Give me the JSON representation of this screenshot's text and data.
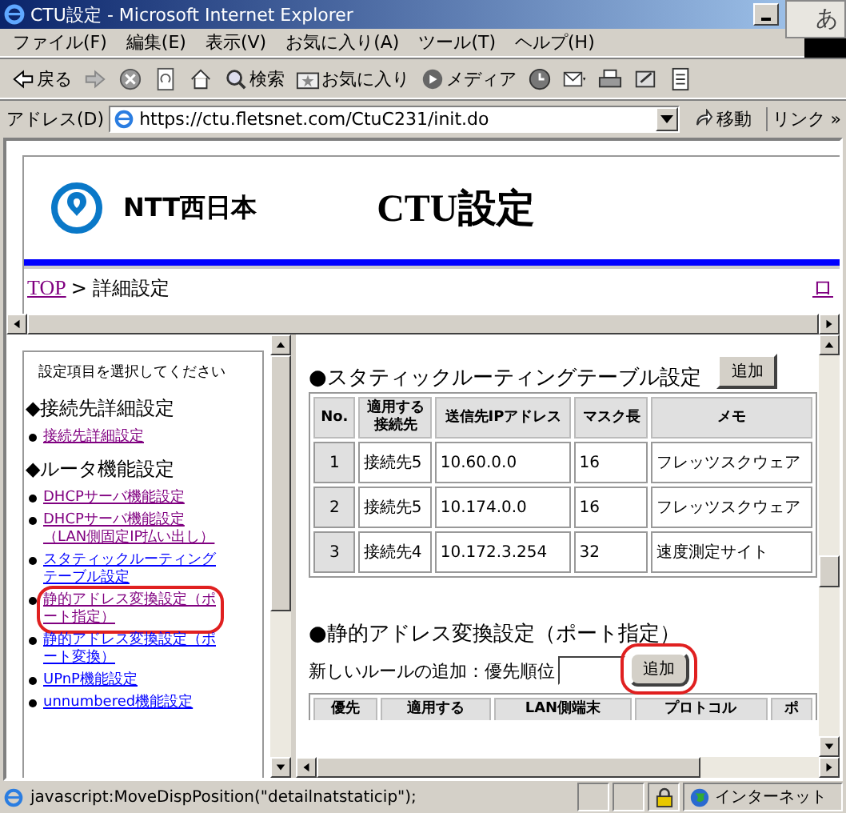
{
  "window": {
    "title": "CTU設定 - Microsoft Internet Explorer",
    "ime_label": "あ"
  },
  "menu": [
    "ファイル(F)",
    "編集(E)",
    "表示(V)",
    "お気に入り(A)",
    "ツール(T)",
    "ヘルプ(H)"
  ],
  "toolbar": [
    {
      "kind": "back",
      "label": "戻る"
    },
    {
      "kind": "forward"
    },
    {
      "kind": "stop"
    },
    {
      "kind": "refresh"
    },
    {
      "kind": "home"
    },
    {
      "kind": "search",
      "label": "検索"
    },
    {
      "kind": "favorites",
      "label": "お気に入り"
    },
    {
      "kind": "media",
      "label": "メディア"
    },
    {
      "kind": "history"
    },
    {
      "kind": "mail"
    },
    {
      "kind": "print"
    },
    {
      "kind": "edit"
    },
    {
      "kind": "discuss"
    }
  ],
  "address": {
    "label": "アドレス(D)",
    "url": "https://ctu.fletsnet.com/CtuC231/init.do",
    "go": "移動",
    "links": "リンク »"
  },
  "header": {
    "brand": "NTT西日本",
    "title": "CTU設定"
  },
  "breadcrumb": {
    "link": "TOP",
    "current": "> 詳細設定",
    "right_link": "ロ"
  },
  "sidebar": {
    "prompt": "設定項目を選択してください",
    "sections": [
      {
        "heading": "◆接続先詳細設定",
        "items": [
          {
            "label": "接続先詳細設定",
            "visited": true,
            "highlighted": false
          }
        ]
      },
      {
        "heading": "◆ルータ機能設定",
        "items": [
          {
            "label": "DHCPサーバ機能設定",
            "visited": true,
            "highlighted": false
          },
          {
            "label": "DHCPサーバ機能設定（LAN側固定IP払い出し）",
            "visited": true,
            "highlighted": false
          },
          {
            "label": "スタティックルーティングテーブル設定",
            "visited": false,
            "highlighted": false
          },
          {
            "label": "静的アドレス変換設定（ポート指定）",
            "visited": true,
            "highlighted": true
          },
          {
            "label": "静的アドレス変換設定（ポート変換）",
            "visited": false,
            "highlighted": false
          },
          {
            "label": "UPnP機能設定",
            "visited": false,
            "highlighted": false
          },
          {
            "label": "unnumbered機能設定",
            "visited": false,
            "highlighted": false
          }
        ]
      }
    ]
  },
  "routing": {
    "heading": "●スタティックルーティングテーブル設定",
    "add_button": "追加",
    "columns": [
      "No.",
      "適用する接続先",
      "送信先IPアドレス",
      "マスク長",
      "メモ"
    ],
    "rows": [
      [
        "1",
        "接続先5",
        "10.60.0.0",
        "16",
        "フレッツスクウェア"
      ],
      [
        "2",
        "接続先5",
        "10.174.0.0",
        "16",
        "フレッツスクウェア"
      ],
      [
        "3",
        "接続先4",
        "10.172.3.254",
        "32",
        "速度測定サイト"
      ]
    ]
  },
  "nat": {
    "heading": "●静的アドレス変換設定（ポート指定）",
    "add_label": "新しいルールの追加：優先順位",
    "add_button": "追加",
    "add_highlighted": true,
    "columns": [
      "優先",
      "適用する",
      "LAN側端末",
      "プロトコル",
      "ポ"
    ]
  },
  "status_bar": {
    "text": "javascript:MoveDispPosition(\"detailnatstaticip\");",
    "zone": "インターネット"
  }
}
